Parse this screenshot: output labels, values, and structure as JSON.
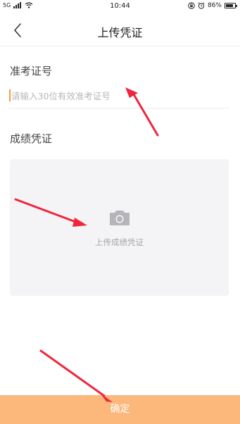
{
  "status_bar": {
    "signal_text": "5G",
    "time": "10:44",
    "battery_text": "86%",
    "battery_level": 0.86
  },
  "header": {
    "title": "上传凭证"
  },
  "form": {
    "exam_id_label": "准考证号",
    "exam_id_value": "",
    "exam_id_placeholder": "请输入30位有效准考证号",
    "voucher_label": "成绩凭证",
    "upload_label": "上传成绩凭证"
  },
  "footer": {
    "confirm_label": "确定"
  },
  "colors": {
    "accent": "#fcb77a",
    "caret": "#f39a3a",
    "annotation_arrow": "#f0263d"
  }
}
